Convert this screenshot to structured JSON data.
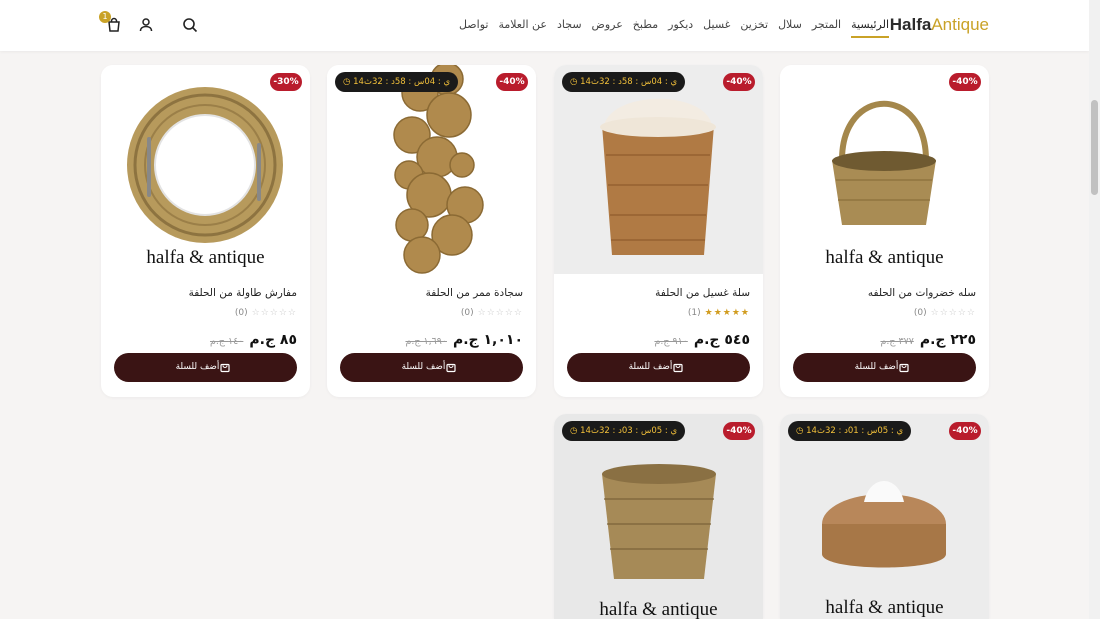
{
  "logo": {
    "part1": "Halfa",
    "part2": "Antique"
  },
  "nav": [
    "الرئيسية",
    "المتجر",
    "سلال",
    "تخزين",
    "غسيل",
    "ديكور",
    "مطبخ",
    "عروض",
    "سجاد",
    "عن العلامة",
    "تواصل"
  ],
  "cart_count": "1",
  "products": [
    {
      "title": "مفارش طاولة من الحلفة",
      "rating": 0,
      "reviews": "(0)",
      "price": "٨٥ ج.م",
      "old_price": "١٤٠ ج.م",
      "discount": "-30%",
      "timer": "",
      "brand_text": "halfa & antique",
      "add_label": "أضف للسلة"
    },
    {
      "title": "سجادة ممر من الحلفة",
      "rating": 0,
      "reviews": "(0)",
      "price": "١,٠١٠ ج.م",
      "old_price": "١,٦٩٠ ج.م",
      "discount": "-40%",
      "timer": "14ي : 04س : 58د : 32ث",
      "brand_text": "",
      "add_label": "أضف للسلة"
    },
    {
      "title": "سلة غسيل من الحلفة",
      "rating": 5,
      "reviews": "(1)",
      "price": "٥٤٥ ج.م",
      "old_price": "٩١٠ ج.م",
      "discount": "-40%",
      "timer": "14ي : 04س : 58د : 32ث",
      "brand_text": "",
      "add_label": "أضف للسلة"
    },
    {
      "title": "سله خضروات من الحلفه",
      "rating": 0,
      "reviews": "(0)",
      "price": "٢٢٥ ج.م",
      "old_price": "٣٧٧ ج.م",
      "discount": "-40%",
      "timer": "",
      "brand_text": "halfa & antique",
      "add_label": "أضف للسلة"
    },
    {
      "title": "",
      "discount": "-40%",
      "timer": "14ي : 05س : 03د : 32ث",
      "brand_text": "halfa & antique"
    },
    {
      "title": "",
      "discount": "-40%",
      "timer": "14ي : 05س : 01د : 32ث",
      "brand_text": "halfa & antique"
    }
  ],
  "colors": {
    "accent": "#c9a227",
    "button": "#3a1414",
    "discount": "#b91c2c",
    "star": "#d19c1f"
  }
}
